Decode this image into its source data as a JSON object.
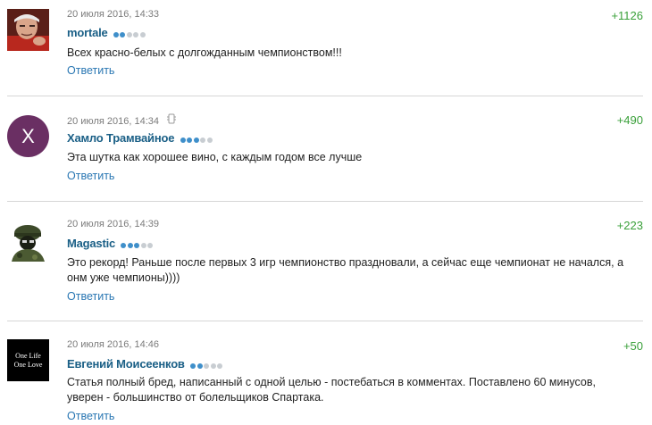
{
  "comments": [
    {
      "date": "20 июля 2016, 14:33",
      "author": "mortale",
      "level": 2,
      "text": "Всех красно-белых с долгожданным чемпионством!!!",
      "reply": "Ответить",
      "rating": "+1126",
      "avatar_bg": "#7a3a2a"
    },
    {
      "date": "20 июля 2016, 14:34",
      "author": "Хамло Трамвайное",
      "level": 3,
      "text": "Эта шутка как хорошее вино, с каждым годом все лучше",
      "reply": "Ответить",
      "rating": "+490",
      "avatar_letter": "Х",
      "avatar_bg": "#6a2f63"
    },
    {
      "date": "20 июля 2016, 14:39",
      "author": "Magastic",
      "level": 3,
      "text_line1": "Это рекорд! Раньше после первых 3 игр чемпионство праздновали, а сейчас еще чемпионат не начался, а",
      "text_line2": "онм уже чемпионы))))",
      "reply": "Ответить",
      "rating": "+223"
    },
    {
      "date": "20 июля 2016, 14:46",
      "author": "Евгений Моисеенков",
      "level": 2,
      "text_line1": "Статья полный бред, написанный с одной целью - постебаться в комментах. Поставлено 60 минусов,",
      "text_line2": "уверен - большинство от болельщиков Спартака.",
      "reply": "Ответить",
      "rating": "+50",
      "avatar_line1": "One Life",
      "avatar_line2": "One Love"
    }
  ]
}
